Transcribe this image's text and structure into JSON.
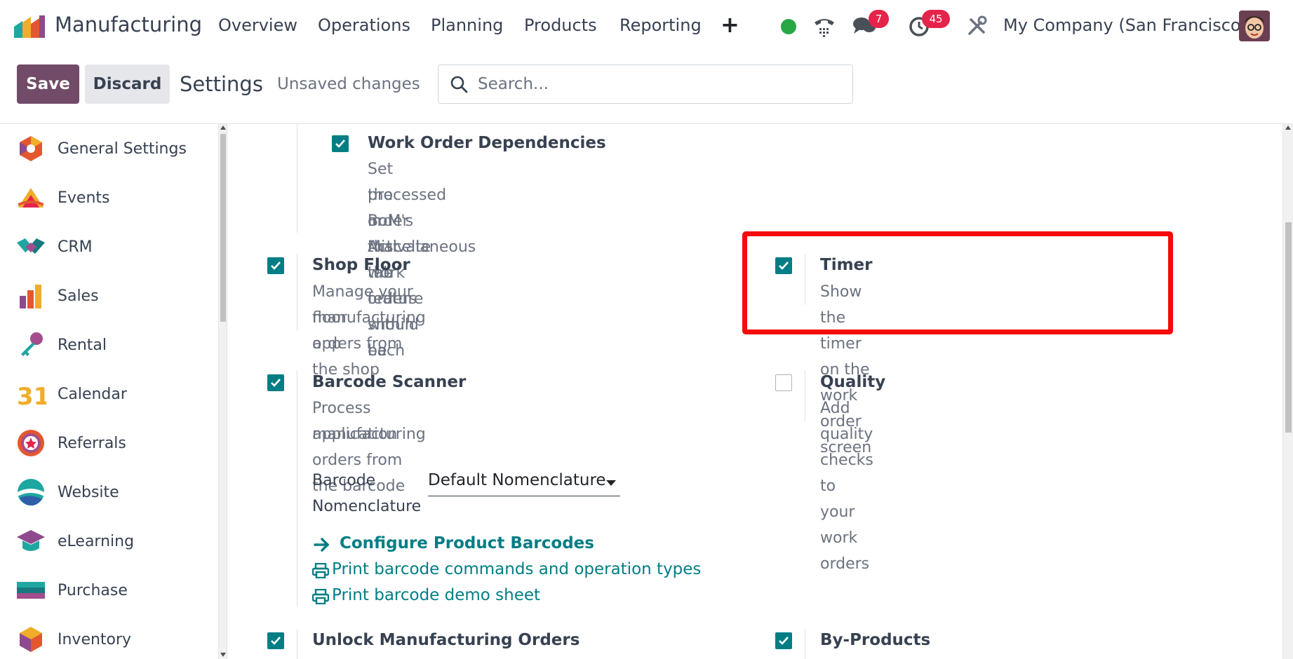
{
  "nav": {
    "app_name": "Manufacturing",
    "menu": [
      "Overview",
      "Operations",
      "Planning",
      "Products",
      "Reporting"
    ],
    "chat_count": "7",
    "activity_count": "45",
    "company": "My Company (San Francisco)",
    "status_color": "#28a745"
  },
  "control": {
    "save_label": "Save",
    "discard_label": "Discard",
    "title": "Settings",
    "unsaved": "Unsaved changes",
    "search_placeholder": "Search..."
  },
  "sidebar": {
    "items": [
      {
        "label": "General Settings",
        "icon": "general-settings-icon"
      },
      {
        "label": "Events",
        "icon": "events-icon"
      },
      {
        "label": "CRM",
        "icon": "crm-icon"
      },
      {
        "label": "Sales",
        "icon": "sales-icon"
      },
      {
        "label": "Rental",
        "icon": "rental-icon"
      },
      {
        "label": "Calendar",
        "icon": "calendar-icon"
      },
      {
        "label": "Referrals",
        "icon": "referrals-icon"
      },
      {
        "label": "Website",
        "icon": "website-icon"
      },
      {
        "label": "eLearning",
        "icon": "elearning-icon"
      },
      {
        "label": "Purchase",
        "icon": "purchase-icon"
      },
      {
        "label": "Inventory",
        "icon": "inventory-icon"
      }
    ],
    "calendar_number": "31"
  },
  "settings": {
    "work_order_dependencies": {
      "title": "Work Order Dependencies",
      "desc_lines": [
        "Set the order that work orders should be",
        "processed in. Activate the feature within each",
        "BoM's Miscellaneous tab"
      ],
      "checked": true
    },
    "shop_floor": {
      "title": "Shop Floor",
      "desc_lines": [
        "Manage your manufacturing orders from the shop",
        "floor app"
      ],
      "checked": true
    },
    "timer": {
      "title": "Timer",
      "desc_lines": [
        "Show the timer on the work order screen"
      ],
      "checked": true
    },
    "barcode_scanner": {
      "title": "Barcode Scanner",
      "desc_lines": [
        "Process manufacturing orders from the barcode",
        "application"
      ],
      "checked": true,
      "nomenclature_label_lines": [
        "Barcode",
        "Nomenclature"
      ],
      "nomenclature_value": "Default Nomenclature",
      "configure_link": "Configure Product Barcodes",
      "print_commands_link": "Print barcode commands and operation types",
      "print_demo_link": "Print barcode demo sheet"
    },
    "quality": {
      "title": "Quality",
      "desc_lines": [
        "Add quality checks to your work orders"
      ],
      "checked": false
    },
    "unlock_mo": {
      "title": "Unlock Manufacturing Orders",
      "checked": true
    },
    "by_products": {
      "title": "By-Products",
      "checked": true
    }
  },
  "colors": {
    "brand": "#714b67",
    "accent": "#017e84",
    "highlight": "#f50b0b",
    "badge": "#e4244a"
  }
}
